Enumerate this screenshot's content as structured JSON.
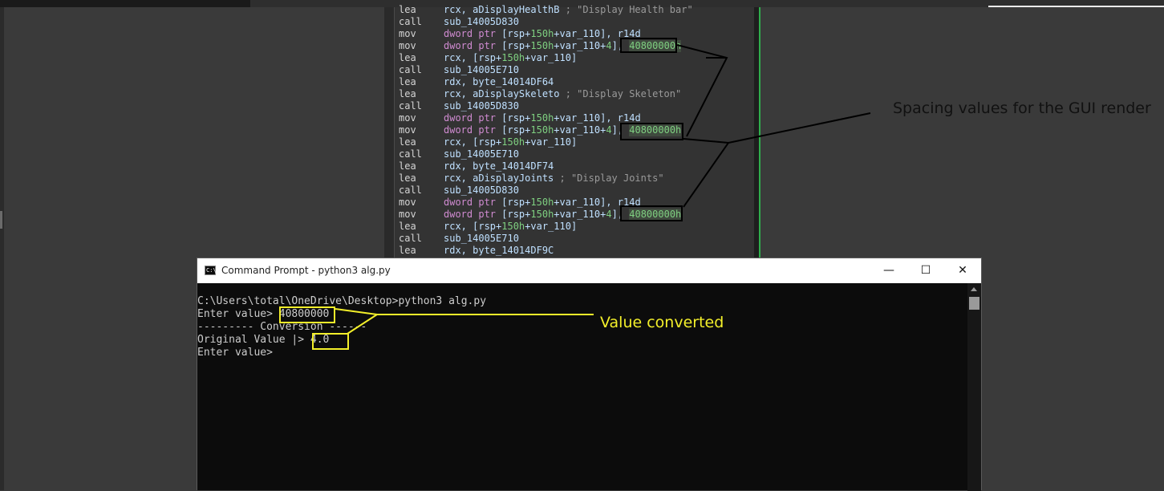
{
  "ida": {
    "lines": [
      {
        "op": "lea",
        "a": "rcx, aDisplayHealthB",
        "cmt": " ; \"Display Health bar\""
      },
      {
        "op": "call",
        "a": "sub_14005D830"
      },
      {
        "op": "mov",
        "kw": "dword ptr",
        "a1": " [rsp+",
        "n1": "150h",
        "a2": "+var_110], r14d"
      },
      {
        "op": "mov",
        "kw": "dword ptr",
        "a1": " [rsp+",
        "n1": "150h",
        "a2": "+var_110+",
        "n2": "4",
        "a3": "], ",
        "hex": "40800000h"
      },
      {
        "op": "lea",
        "a": "rcx, [rsp+",
        "n1": "150h",
        "a2": "+var_110]"
      },
      {
        "op": "call",
        "a": "sub_14005E710"
      },
      {
        "op": "lea",
        "a": "rdx, byte_14014DF64"
      },
      {
        "op": "lea",
        "a": "rcx, aDisplaySkeleto",
        "cmt": " ; \"Display Skeleton\""
      },
      {
        "op": "call",
        "a": "sub_14005D830"
      },
      {
        "op": "mov",
        "kw": "dword ptr",
        "a1": " [rsp+",
        "n1": "150h",
        "a2": "+var_110], r14d"
      },
      {
        "op": "mov",
        "kw": "dword ptr",
        "a1": " [rsp+",
        "n1": "150h",
        "a2": "+var_110+",
        "n2": "4",
        "a3": "], ",
        "hex": "40800000h"
      },
      {
        "op": "lea",
        "a": "rcx, [rsp+",
        "n1": "150h",
        "a2": "+var_110]"
      },
      {
        "op": "call",
        "a": "sub_14005E710"
      },
      {
        "op": "lea",
        "a": "rdx, byte_14014DF74"
      },
      {
        "op": "lea",
        "a": "rcx, aDisplayJoints",
        "cmt": " ; \"Display Joints\""
      },
      {
        "op": "call",
        "a": "sub_14005D830"
      },
      {
        "op": "mov",
        "kw": "dword ptr",
        "a1": " [rsp+",
        "n1": "150h",
        "a2": "+var_110], r14d"
      },
      {
        "op": "mov",
        "kw": "dword ptr",
        "a1": " [rsp+",
        "n1": "150h",
        "a2": "+var_110+",
        "n2": "4",
        "a3": "], ",
        "hex": "40800000h"
      },
      {
        "op": "lea",
        "a": "rcx, [rsp+",
        "n1": "150h",
        "a2": "+var_110]"
      },
      {
        "op": "call",
        "a": "sub_14005E710"
      },
      {
        "op": "lea",
        "a": "rdx, byte_14014DF9C"
      }
    ]
  },
  "annotations": {
    "spacing_label": "Spacing values for the GUI render",
    "converted_label": "Value converted"
  },
  "cmd": {
    "title": "Command Prompt - python3  alg.py",
    "icon_text": "C:\\",
    "minimize": "—",
    "maximize": "☐",
    "close": "✕",
    "lines": [
      "C:\\Users\\total\\OneDrive\\Desktop>python3 alg.py",
      "Enter value> 40800000",
      "--------- Conversion ------",
      "Original Value |> 4.0",
      "Enter value>"
    ]
  },
  "colors": {
    "highlight_yellow": "#f3ef2a",
    "ida_green": "#2fae4c"
  }
}
